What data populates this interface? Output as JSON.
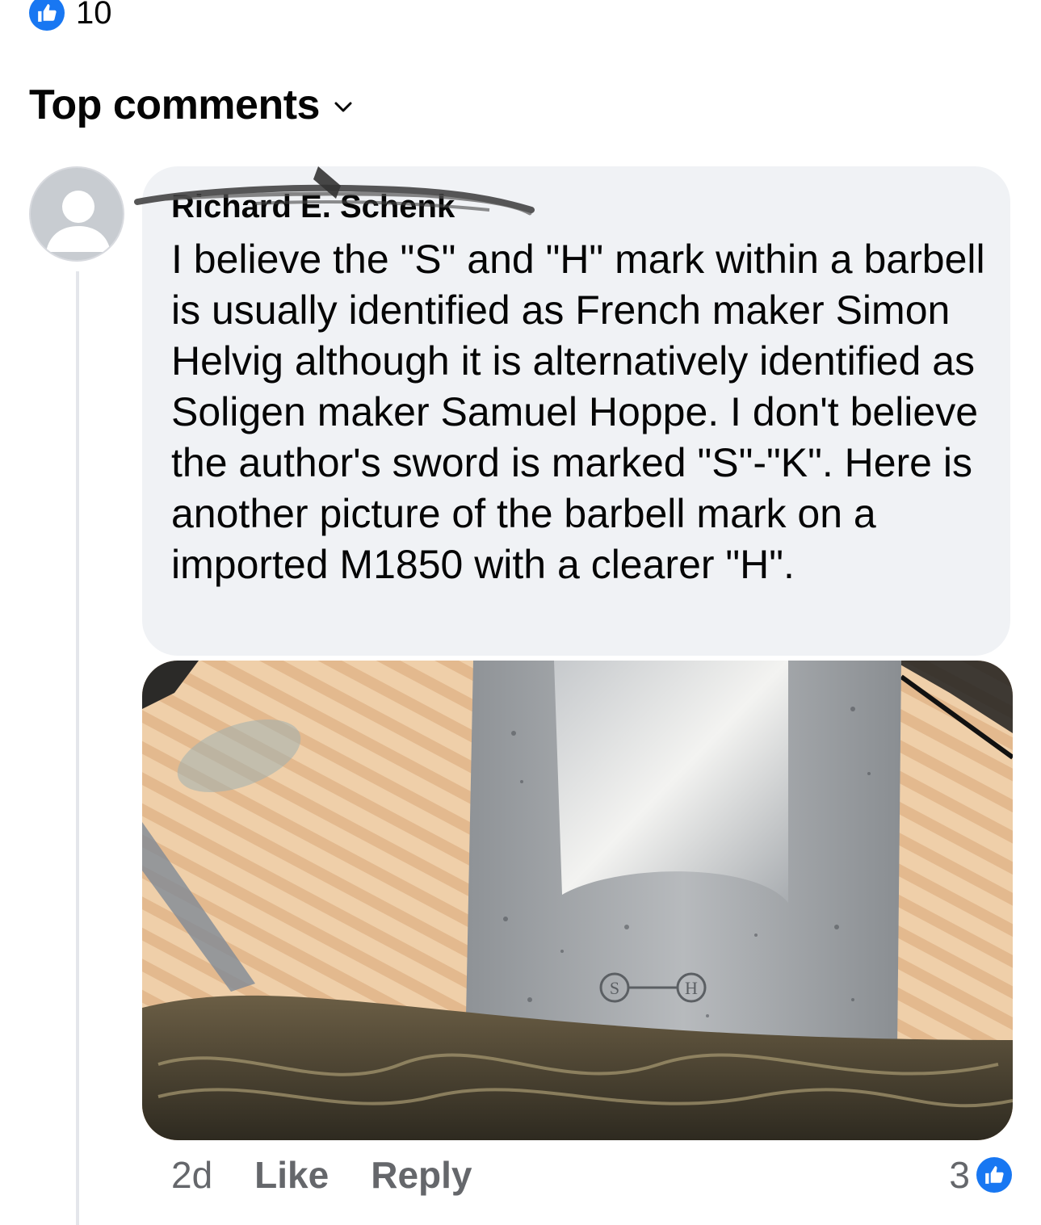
{
  "post": {
    "reaction_count": "10",
    "reaction_icon": "like-icon"
  },
  "comments_section": {
    "title": "Top comments",
    "sort_icon": "chevron-down-icon"
  },
  "comment": {
    "author": "Richard E. Schenk",
    "text": "I believe the \"S\" and \"H\" mark within a barbell is usually identified as French maker Simon Helvig although it is alternatively identified as Soligen maker Samuel Hoppe.  I don't believe the author's sword is marked \"S\"-\"K\".  Here is another picture of the barbell mark on a imported M1850 with a clearer \"H\".",
    "time": "2d",
    "like_label": "Like",
    "reply_label": "Reply",
    "reaction_count": "3",
    "stamp_letters": [
      "S",
      "H"
    ]
  },
  "colors": {
    "accent": "#1877f2",
    "bubble": "#f0f2f5",
    "secondary_text": "#65676b"
  }
}
